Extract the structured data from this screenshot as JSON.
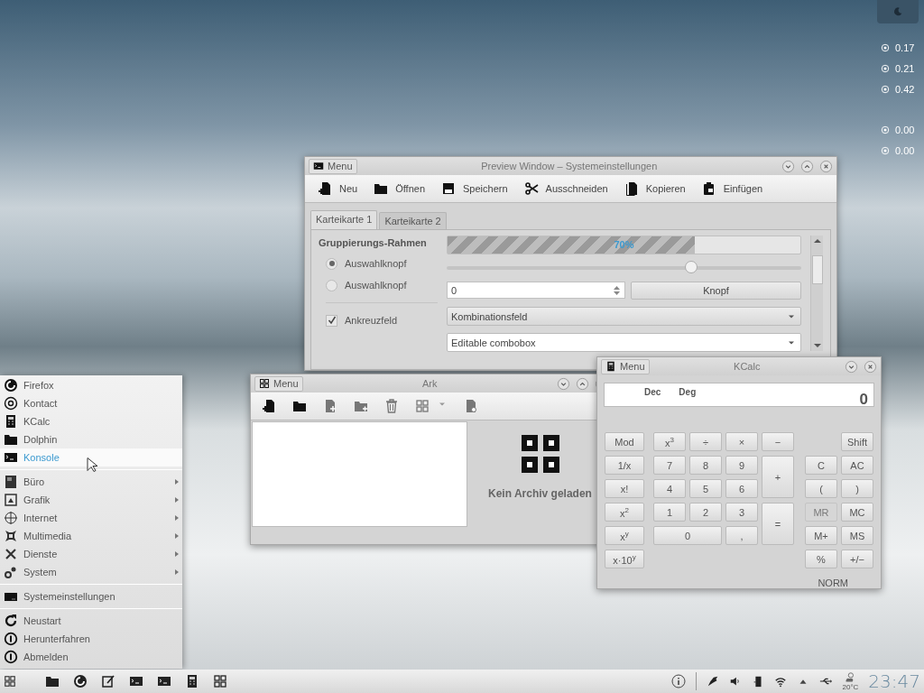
{
  "desktop_widget": {
    "readings": [
      {
        "value": "0.17"
      },
      {
        "value": "0.21"
      },
      {
        "value": "0.42"
      },
      {
        "value": "0.00"
      },
      {
        "value": "0.00"
      }
    ]
  },
  "preview_window": {
    "menu_button": "Menu",
    "title": "Preview Window – Systemeinstellungen",
    "toolbar": [
      {
        "label": "Neu"
      },
      {
        "label": "Öffnen"
      },
      {
        "label": "Speichern"
      },
      {
        "label": "Ausschneiden"
      },
      {
        "label": "Kopieren"
      },
      {
        "label": "Einfügen"
      }
    ],
    "tabs": [
      {
        "label": "Karteikarte 1",
        "selected": true
      },
      {
        "label": "Karteikarte 2",
        "selected": false
      }
    ],
    "group_title": "Gruppierungs-Rahmen",
    "radios": [
      {
        "label": "Auswahlknopf",
        "selected": true
      },
      {
        "label": "Auswahlknopf",
        "selected": false
      }
    ],
    "checkbox": {
      "label": "Ankreuzfeld",
      "checked": true
    },
    "progress": {
      "level": 0.7,
      "reading": "70%"
    },
    "slider": {
      "level": 0.69
    },
    "spinbox": {
      "value": "0"
    },
    "button": "Knopf",
    "combobox": {
      "value": "Kombinationsfeld"
    },
    "editable_combobox": {
      "value": "Editable combobox"
    }
  },
  "ark_window": {
    "menu_button": "Menu",
    "title": "Ark",
    "empty_message": "Kein Archiv geladen"
  },
  "kcalc_window": {
    "menu_button": "Menu",
    "title": "KCalc",
    "display": {
      "base": "Dec",
      "angle": "Deg",
      "value": "0"
    },
    "function_keys": [
      {
        "label": "Mod"
      },
      {
        "label": "1/x"
      },
      {
        "label": "x!"
      },
      {
        "label": "x$^{2}$"
      },
      {
        "label": "x$^{y}$"
      },
      {
        "label": "x·10$^{y}$"
      }
    ],
    "number_keys": [
      {
        "label": "x$^{3}$",
        "kind": "key"
      },
      {
        "label": "÷",
        "kind": "key"
      },
      {
        "label": "×",
        "kind": "key"
      },
      {
        "label": "−",
        "kind": "key"
      },
      {
        "label": "7",
        "kind": "key"
      },
      {
        "label": "8",
        "kind": "key"
      },
      {
        "label": "9",
        "kind": "key"
      },
      {
        "label": "+",
        "kind": "tall"
      },
      {
        "label": "4",
        "kind": "key"
      },
      {
        "label": "5",
        "kind": "key"
      },
      {
        "label": "6",
        "kind": "key"
      },
      {
        "label": "1",
        "kind": "key"
      },
      {
        "label": "2",
        "kind": "key"
      },
      {
        "label": "3",
        "kind": "key"
      },
      {
        "label": "=",
        "kind": "tall"
      },
      {
        "label": "0",
        "kind": "wide"
      },
      {
        "label": ",",
        "kind": "key"
      }
    ],
    "memory_keys": [
      {
        "label": "Shift",
        "kind": "offset",
        "disabled": false
      },
      {
        "label": "C",
        "kind": "key",
        "disabled": false
      },
      {
        "label": "AC",
        "kind": "key",
        "disabled": false
      },
      {
        "label": "(",
        "kind": "key",
        "disabled": false
      },
      {
        "label": ")",
        "kind": "key",
        "disabled": false
      },
      {
        "label": "MR",
        "kind": "key",
        "disabled": true
      },
      {
        "label": "MC",
        "kind": "key",
        "disabled": false
      },
      {
        "label": "M+",
        "kind": "key",
        "disabled": false
      },
      {
        "label": "MS",
        "kind": "key",
        "disabled": false
      },
      {
        "label": "%",
        "kind": "key",
        "disabled": false
      },
      {
        "label": "+/−",
        "kind": "key",
        "disabled": false
      }
    ],
    "status": "NORM"
  },
  "start_menu": {
    "favorites": [
      {
        "label": "Firefox",
        "selected": false
      },
      {
        "label": "Kontact",
        "selected": false
      },
      {
        "label": "KCalc",
        "selected": false
      },
      {
        "label": "Dolphin",
        "selected": false
      },
      {
        "label": "Konsole",
        "selected": true
      }
    ],
    "categories": [
      {
        "label": "Büro"
      },
      {
        "label": "Grafik"
      },
      {
        "label": "Internet"
      },
      {
        "label": "Multimedia"
      },
      {
        "label": "Dienste"
      },
      {
        "label": "System"
      }
    ],
    "settings": {
      "label": "Systemeinstellungen"
    },
    "session": [
      {
        "label": "Neustart"
      },
      {
        "label": "Herunterfahren"
      },
      {
        "label": "Abmelden"
      }
    ]
  },
  "taskbar": {
    "weather": "20°C",
    "clock": "23:47"
  }
}
